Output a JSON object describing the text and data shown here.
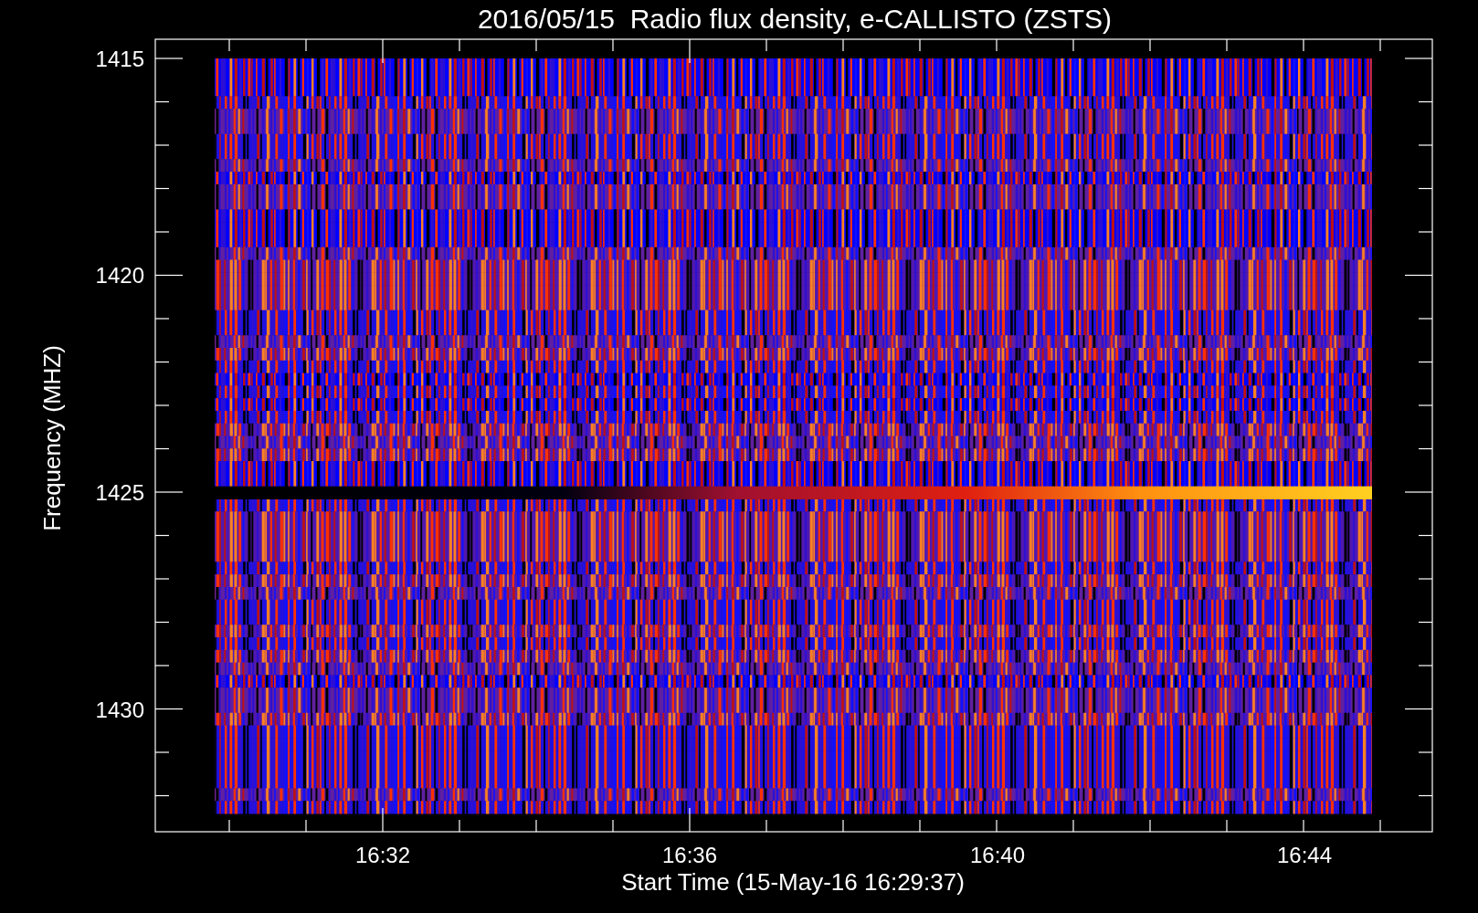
{
  "title": "2016/05/15  Radio flux density, e-CALLISTO (ZSTS)",
  "plot": {
    "xlabel": "Start Time (15-May-16 16:29:37)",
    "ylabel": "Frequency (MHZ)",
    "xticks": [
      {
        "label": "16:32"
      },
      {
        "label": "16:36"
      },
      {
        "label": "16:40"
      },
      {
        "label": "16:44"
      }
    ],
    "yticks": [
      {
        "label": "1415"
      },
      {
        "label": "1420"
      },
      {
        "label": "1425"
      },
      {
        "label": "1430"
      }
    ]
  }
}
